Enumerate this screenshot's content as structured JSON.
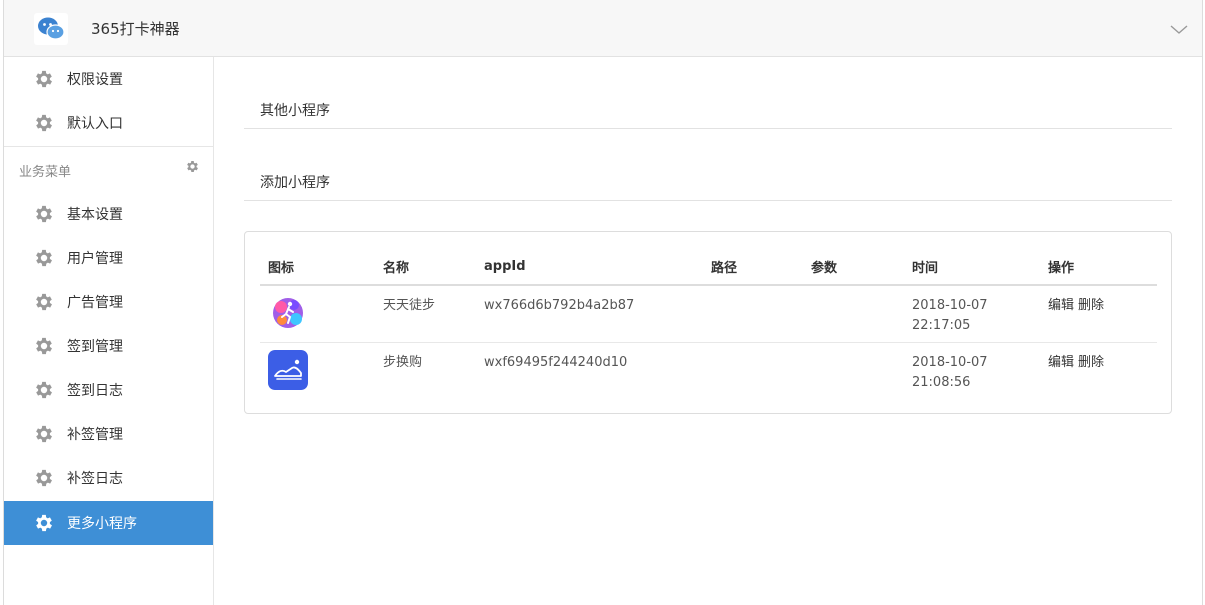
{
  "app": {
    "title": "365打卡神器",
    "logo_icon": "wechat-icon",
    "accent": "#3e8fd6"
  },
  "sidebar": {
    "top_items": [
      {
        "label": "权限设置",
        "icon": "gear-icon"
      },
      {
        "label": "默认入口",
        "icon": "gear-icon"
      }
    ],
    "section_title": "业务菜单",
    "items": [
      {
        "label": "基本设置",
        "icon": "gear-icon"
      },
      {
        "label": "用户管理",
        "icon": "gear-icon"
      },
      {
        "label": "广告管理",
        "icon": "gear-icon"
      },
      {
        "label": "签到管理",
        "icon": "gear-icon"
      },
      {
        "label": "签到日志",
        "icon": "gear-icon"
      },
      {
        "label": "补签管理",
        "icon": "gear-icon"
      },
      {
        "label": "补签日志",
        "icon": "gear-icon"
      },
      {
        "label": "更多小程序",
        "icon": "gear-icon",
        "active": true
      }
    ]
  },
  "main": {
    "tabs": [
      {
        "label": "其他小程序"
      },
      {
        "label": "添加小程序"
      }
    ],
    "table": {
      "headers": [
        "图标",
        "名称",
        "appId",
        "路径",
        "参数",
        "时间",
        "操作"
      ],
      "rows": [
        {
          "name": "天天徒步",
          "appid": "wx766d6b792b4a2b87",
          "path": "",
          "params": "",
          "date": "2018-10-07",
          "time": "22:17:05",
          "edit": "编辑",
          "delete": "删除",
          "icon": "walking-figure-icon"
        },
        {
          "name": "步换购",
          "appid": "wxf69495f244240d10",
          "path": "",
          "params": "",
          "date": "2018-10-07",
          "time": "21:08:56",
          "edit": "编辑",
          "delete": "删除",
          "icon": "shoe-icon"
        }
      ]
    }
  }
}
